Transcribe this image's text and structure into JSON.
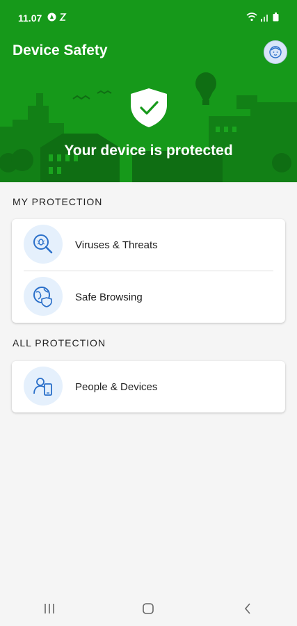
{
  "status_bar": {
    "time": "11.07"
  },
  "header": {
    "title": "Device Safety",
    "status_message": "Your device is protected"
  },
  "sections": {
    "my_protection": {
      "label": "MY PROTECTION",
      "items": [
        {
          "label": "Viruses & Threats",
          "icon": "virus-search-icon"
        },
        {
          "label": "Safe Browsing",
          "icon": "globe-shield-icon"
        }
      ]
    },
    "all_protection": {
      "label": "ALL PROTECTION",
      "items": [
        {
          "label": "People & Devices",
          "icon": "person-phone-icon"
        }
      ]
    }
  },
  "colors": {
    "header_green": "#16991a",
    "icon_bg": "#e5f0fc",
    "icon_blue": "#2a6fc9"
  }
}
